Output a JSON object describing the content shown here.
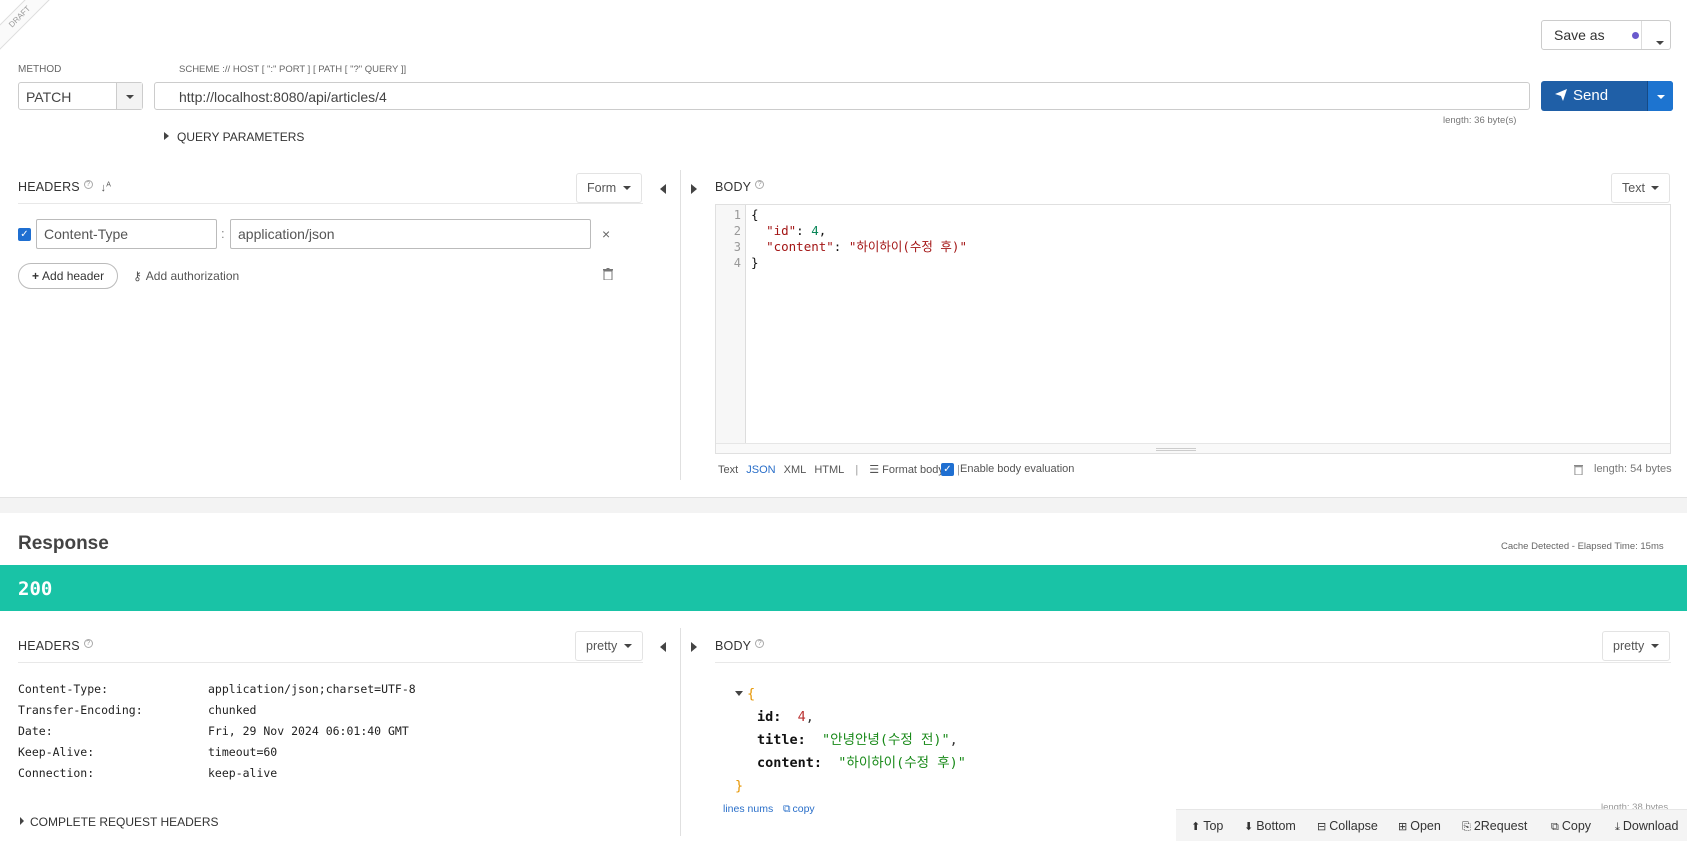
{
  "ribbon": "DRAFT",
  "save_as": "Save as",
  "method": {
    "label": "METHOD",
    "value": "PATCH"
  },
  "url": {
    "label": "SCHEME :// HOST [ \":\" PORT ] [ PATH [ \"?\" QUERY ]]",
    "value": "http://localhost:8080/api/articles/4",
    "length": "length: 36 byte(s)"
  },
  "send": "Send",
  "query_params": "QUERY PARAMETERS",
  "request": {
    "headers_title": "HEADERS",
    "headers_mode": "Form",
    "header_rows": [
      {
        "name": "Content-Type",
        "value": "application/json"
      }
    ],
    "add_header": "Add header",
    "add_authorization": "Add authorization",
    "body_title": "BODY",
    "body_mode": "Text",
    "line_numbers": [
      "1",
      "2",
      "3",
      "4"
    ],
    "body_lines": [
      {
        "pre": "{",
        "key": "",
        "sep": "",
        "val": "",
        "post": ""
      },
      {
        "pre": "  ",
        "key": "\"id\"",
        "sep": ": ",
        "num": "4",
        "post": ","
      },
      {
        "pre": "  ",
        "key": "\"content\"",
        "sep": ": ",
        "str": "\"하이하이(수정 후)\"",
        "post": ""
      },
      {
        "pre": "}",
        "key": "",
        "sep": "",
        "val": "",
        "post": ""
      }
    ],
    "formats": [
      "Text",
      "JSON",
      "XML",
      "HTML"
    ],
    "active_format": "JSON",
    "format_body": "Format body",
    "enable_eval": "Enable body evaluation",
    "body_length": "length: 54 bytes"
  },
  "response": {
    "title": "Response",
    "cache_info": "Cache Detected - Elapsed Time: 15ms",
    "status": "200",
    "status_color": "#19c3a6",
    "headers_title": "HEADERS",
    "headers_mode": "pretty",
    "headers": [
      {
        "name": "Content-Type:",
        "value": "application/json;charset=UTF-8"
      },
      {
        "name": "Transfer-Encoding:",
        "value": "chunked"
      },
      {
        "name": "Date:",
        "value": "Fri, 29 Nov 2024 06:01:40 GMT"
      },
      {
        "name": "Keep-Alive:",
        "value": "timeout=60"
      },
      {
        "name": "Connection:",
        "value": "keep-alive"
      }
    ],
    "complete_headers": "COMPLETE REQUEST HEADERS",
    "body_title": "BODY",
    "body_mode": "pretty",
    "body": {
      "open": "{",
      "close": "}",
      "fields": [
        {
          "key": "id:",
          "value": "4",
          "type": "num",
          "comma": ","
        },
        {
          "key": "title:",
          "value": "\"안녕안녕(수정 전)\"",
          "type": "str",
          "comma": ","
        },
        {
          "key": "content:",
          "value": "\"하이하이(수정 후)\"",
          "type": "str",
          "comma": ""
        }
      ]
    },
    "lines_nums": "lines nums",
    "copy": "copy",
    "length": "length: 38 bytes"
  },
  "toolbar": [
    "Top",
    "Bottom",
    "Collapse",
    "Open",
    "2Request",
    "Copy",
    "Download"
  ]
}
